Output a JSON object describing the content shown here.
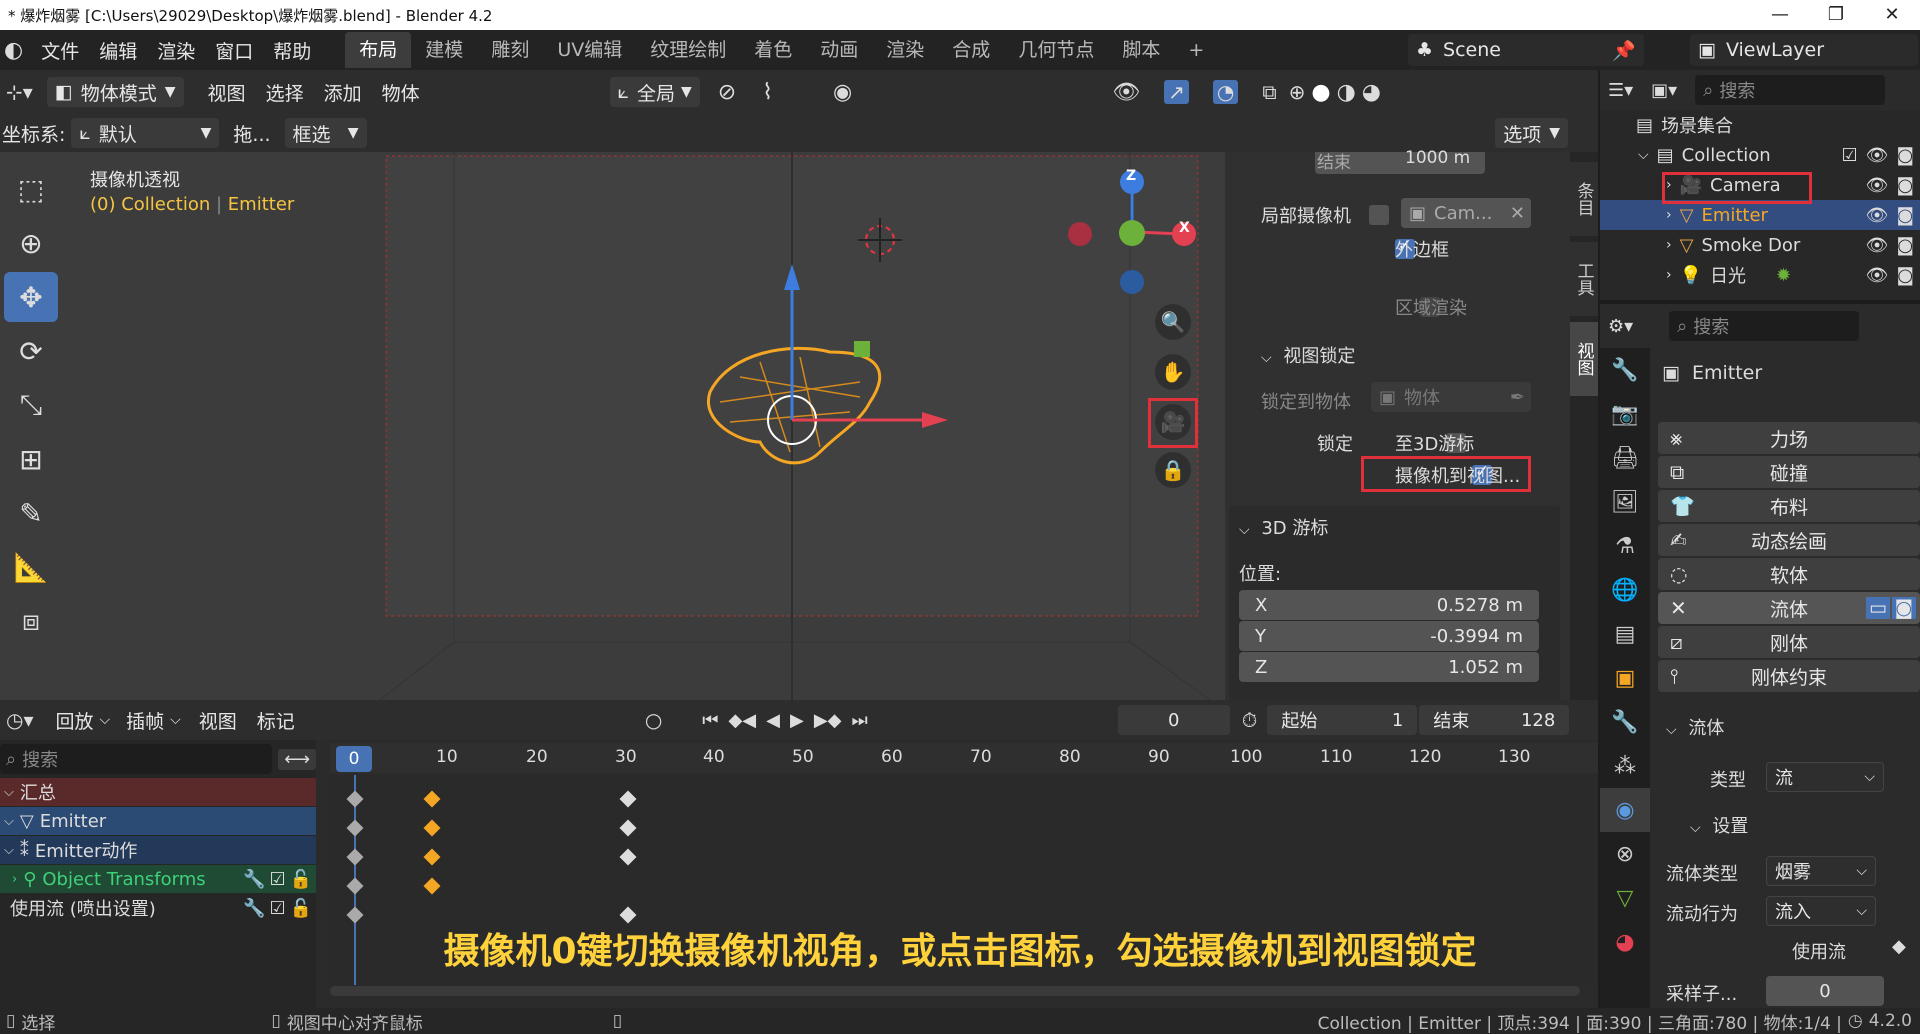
{
  "window": {
    "title": "* 爆炸烟雾 [C:\\Users\\29029\\Desktop\\爆炸烟雾.blend] - Blender 4.2",
    "min": "—",
    "max": "❐",
    "close": "✕"
  },
  "menu": [
    "文件",
    "编辑",
    "渲染",
    "窗口",
    "帮助"
  ],
  "workspaces": [
    "布局",
    "建模",
    "雕刻",
    "UV编辑",
    "纹理绘制",
    "着色",
    "动画",
    "渲染",
    "合成",
    "几何节点",
    "脚本",
    "+"
  ],
  "scene": "Scene",
  "viewlayer": "ViewLayer",
  "header": {
    "mode": "物体模式",
    "view": "视图",
    "select": "选择",
    "add": "添加",
    "object": "物体",
    "orientation": "全局",
    "coord_label": "坐标系:",
    "coord_value": "默认",
    "drag": "拖...",
    "box": "框选",
    "options": "选项"
  },
  "viewport": {
    "title": "摄像机透视",
    "collection": "(0) Collection",
    "object": "Emitter",
    "axis_z": "Z",
    "axis_x": "X"
  },
  "sidebar": {
    "end_label": "结束",
    "end_value": "1000 m",
    "local_cam_label": "局部摄像机",
    "local_cam_value": "Cam...",
    "border_label": "外边框",
    "region_label": "区域渲染",
    "viewlock_title": "视图锁定",
    "lock_obj_label": "锁定到物体",
    "lock_obj_value": "物体",
    "lock_label": "锁定",
    "to_cursor_label": "至3D游标",
    "cam_to_view_label": "摄像机到视图...",
    "cursor_title": "3D 游标",
    "position_label": "位置:",
    "x_label": "X",
    "x_value": "0.5278 m",
    "y_label": "Y",
    "y_value": "-0.3994 m",
    "z_label": "Z",
    "z_value": "1.052 m",
    "tabs": [
      "条目",
      "工具",
      "视图"
    ]
  },
  "outliner": {
    "search": "搜索",
    "root": "场景集合",
    "collection": "Collection",
    "items": [
      {
        "name": "Camera",
        "color": "#e8a54a"
      },
      {
        "name": "Emitter",
        "color": "#e8a54a"
      },
      {
        "name": "Smoke Dor",
        "color": "#e8a54a"
      },
      {
        "name": "日光",
        "color": "#e8a54a"
      }
    ]
  },
  "properties": {
    "search": "搜索",
    "object": "Emitter",
    "physics": [
      "力场",
      "碰撞",
      "布料",
      "动态绘画",
      "软体",
      "流体",
      "刚体",
      "刚体约束"
    ],
    "fluid_title": "流体",
    "type_label": "类型",
    "type_value": "流",
    "settings_title": "设置",
    "flow_type_label": "流体类型",
    "flow_type_value": "烟雾",
    "flow_behavior_label": "流动行为",
    "flow_behavior_value": "流入",
    "use_flow_label": "使用流",
    "sampling_label": "采样子...",
    "sampling_value": "0"
  },
  "timeline": {
    "playback": "回放",
    "keying": "插帧",
    "view": "视图",
    "marker": "标记",
    "current": "0",
    "start_label": "起始",
    "start": "1",
    "end_label": "结束",
    "end": "128",
    "search": "搜索",
    "ticks": [
      "0",
      "10",
      "20",
      "30",
      "40",
      "50",
      "60",
      "70",
      "80",
      "90",
      "100",
      "110",
      "120",
      "130"
    ],
    "channels": [
      "汇总",
      "Emitter",
      "Emitter动作",
      "Object Transforms",
      "使用流 (喷出设置)"
    ]
  },
  "subtitle": "摄像机0键切换摄像机视角，或点击图标，勾选摄像机到视图锁定",
  "status": {
    "select": "选择",
    "center": "视图中心对齐鼠标",
    "stats": "Collection | Emitter | 顶点:394 | 面:390 | 三角面:780 | 物体:1/4 |",
    "version": "4.2.0"
  }
}
